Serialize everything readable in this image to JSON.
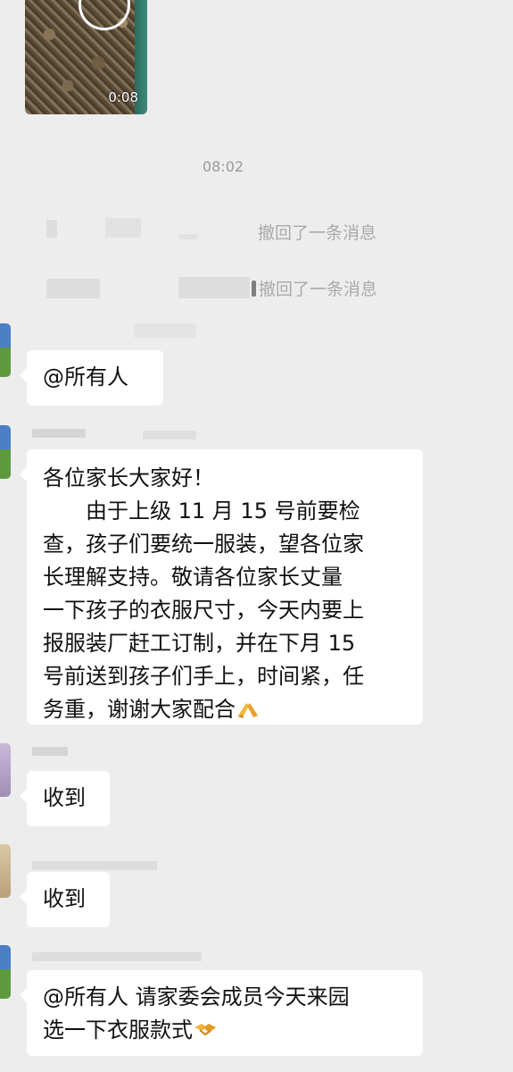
{
  "video": {
    "duration": "0:08"
  },
  "time_divider": "08:02",
  "recall_notices": [
    {
      "text": "撤回了一条消息"
    },
    {
      "text": "撤回了一条消息"
    }
  ],
  "messages": [
    {
      "text": "@所有人"
    },
    {
      "lines": [
        "各位家长大家好！",
        "　　由于上级 11 月 15 号前要检",
        "查，孩子们要统一服装，望各位家",
        "长理解支持。敬请各位家长丈量",
        "一下孩子的衣服尺寸，今天内要上",
        "报服装厂赶工订制，并在下月 15",
        "号前送到孩子们手上，时间紧，任",
        "务重，谢谢大家配合"
      ],
      "emoji": "folded-hands-emoji"
    },
    {
      "text": "收到"
    },
    {
      "text": "收到"
    },
    {
      "lines": [
        "@所有人  请家委会成员今天来园",
        "选一下衣服款式"
      ],
      "emoji": "handshake-emoji"
    }
  ]
}
